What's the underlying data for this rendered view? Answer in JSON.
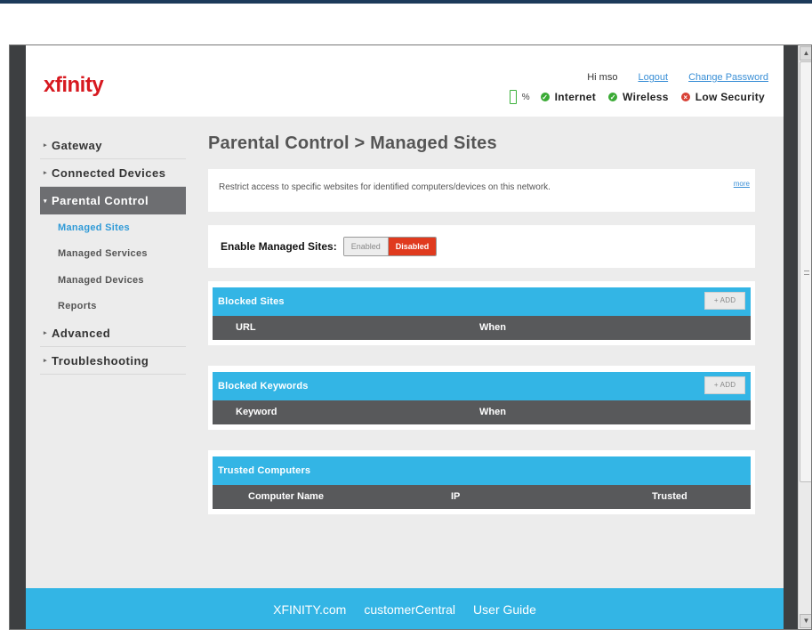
{
  "brand": {
    "logo_text": "xfinity",
    "accent": "#33b5e5",
    "logo_color": "#d71920"
  },
  "header": {
    "greeting": "Hi mso",
    "logout_label": "Logout",
    "change_password_label": "Change Password",
    "battery_pct": "%",
    "status": [
      {
        "label": "Internet",
        "icon": "check-icon",
        "state": "ok"
      },
      {
        "label": "Wireless",
        "icon": "check-icon",
        "state": "ok"
      },
      {
        "label": "Low Security",
        "icon": "warning-icon",
        "state": "warn"
      }
    ]
  },
  "sidebar": {
    "items": [
      {
        "label": "Gateway"
      },
      {
        "label": "Connected Devices"
      },
      {
        "label": "Parental Control",
        "active": true
      },
      {
        "label": "Managed Sites",
        "sub": true,
        "active": true
      },
      {
        "label": "Managed Services",
        "sub": true
      },
      {
        "label": "Managed Devices",
        "sub": true
      },
      {
        "label": "Reports",
        "sub": true
      },
      {
        "label": "Advanced"
      },
      {
        "label": "Troubleshooting"
      }
    ]
  },
  "main": {
    "title": "Parental Control > Managed Sites",
    "description": "Restrict access to specific websites for identified computers/devices on this network.",
    "more_label": "more",
    "enable_label": "Enable Managed Sites:",
    "toggle_enabled": "Enabled",
    "toggle_disabled": "Disabled",
    "add_label": "+ ADD",
    "tables": {
      "blocked_sites": {
        "title": "Blocked Sites",
        "columns": [
          "URL",
          "When"
        ]
      },
      "blocked_keywords": {
        "title": "Blocked Keywords",
        "columns": [
          "Keyword",
          "When"
        ]
      },
      "trusted_computers": {
        "title": "Trusted Computers",
        "columns": [
          "Computer Name",
          "IP",
          "Trusted"
        ]
      }
    }
  },
  "footer": {
    "links": [
      "XFINITY.com",
      "customerCentral",
      "User Guide"
    ]
  }
}
